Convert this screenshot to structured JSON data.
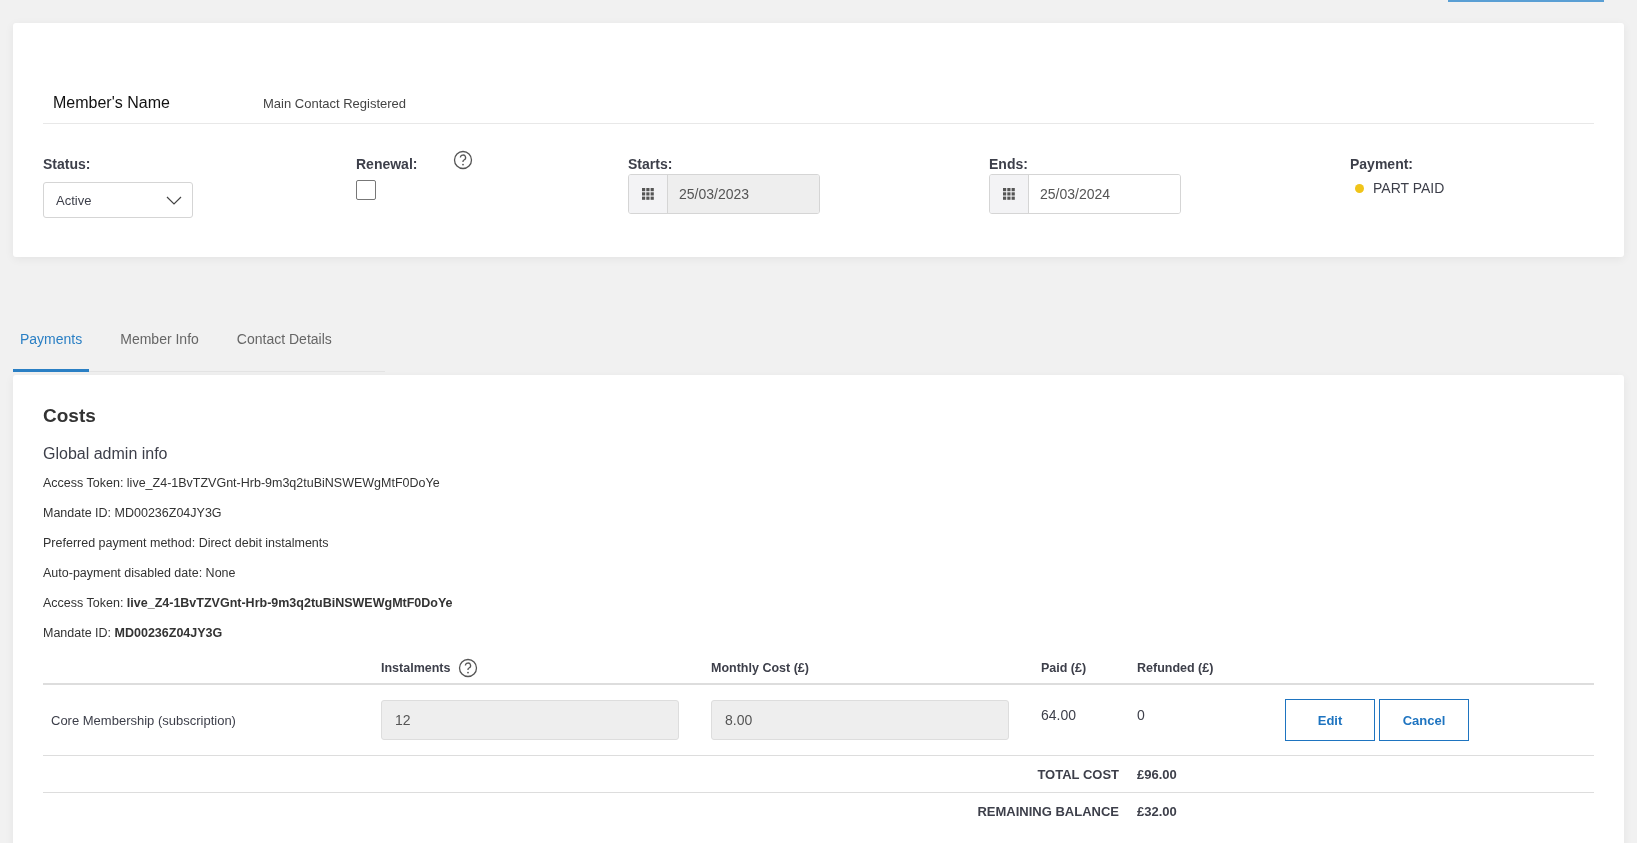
{
  "header": {
    "member_name_label": "Member's Name",
    "member_name_value": "Main Contact Registered",
    "status": {
      "label": "Status:",
      "value": "Active"
    },
    "renewal": {
      "label": "Renewal:",
      "checked": false
    },
    "starts": {
      "label": "Starts:",
      "value": "25/03/2023",
      "disabled": true
    },
    "ends": {
      "label": "Ends:",
      "value": "25/03/2024",
      "disabled": false
    },
    "payment": {
      "label": "Payment:",
      "value": "PART PAID",
      "color": "#f0c419"
    }
  },
  "tabs": [
    {
      "label": "Payments",
      "selected": true
    },
    {
      "label": "Member Info",
      "selected": false
    },
    {
      "label": "Contact Details",
      "selected": false
    }
  ],
  "costs": {
    "title": "Costs",
    "subtitle": "Global admin info",
    "info_lines": [
      "Access Token: live_Z4-1BvTZVGnt-Hrb-9m3q2tuBiNSWEWgMtF0DoYe",
      "Mandate ID: MD00236Z04JY3G",
      "Preferred payment method: Direct debit instalments",
      "Auto-payment disabled date: None",
      "Access Token: **live_Z4-1BvTZVGnt-Hrb-9m3q2tuBiNSWEWgMtF0DoYe**",
      "Mandate ID: **MD00236Z04JY3G**"
    ],
    "columns": [
      {
        "label": "Instalments",
        "help": true
      },
      {
        "label": "Monthly Cost (£)",
        "help": false
      },
      {
        "label": "Paid (£)",
        "help": false
      },
      {
        "label": "Refunded (£)",
        "help": false
      }
    ],
    "rows": [
      {
        "name": "Core Membership (subscription)",
        "instalments": {
          "value": "12",
          "disabled": true
        },
        "monthly_cost": {
          "value": "8.00",
          "disabled": true
        },
        "paid": "64.00",
        "refunded": "0",
        "actions": [
          "Edit",
          "Cancel"
        ]
      }
    ],
    "totals": [
      {
        "label": "TOTAL COST",
        "value": "£96.00"
      },
      {
        "label": "REMAINING BALANCE",
        "value": "£32.00"
      }
    ]
  }
}
